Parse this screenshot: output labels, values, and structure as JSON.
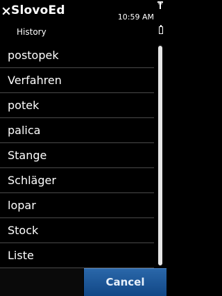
{
  "header": {
    "app_title": "SlovoEd",
    "subtitle": "History",
    "close_icon": "close-icon",
    "status": {
      "time": "10:59 AM",
      "signal_icon": "signal-icon",
      "battery_icon": "battery-icon"
    }
  },
  "history": {
    "items": [
      {
        "label": "postopek"
      },
      {
        "label": "Verfahren"
      },
      {
        "label": "potek"
      },
      {
        "label": "palica"
      },
      {
        "label": "Stange"
      },
      {
        "label": "Schläger"
      },
      {
        "label": "lopar"
      },
      {
        "label": "Stock"
      },
      {
        "label": "Liste"
      }
    ]
  },
  "footer": {
    "cancel_label": "Cancel"
  },
  "colors": {
    "background": "#000000",
    "accent": "#1f5a99",
    "divider": "#4a4a4a"
  }
}
